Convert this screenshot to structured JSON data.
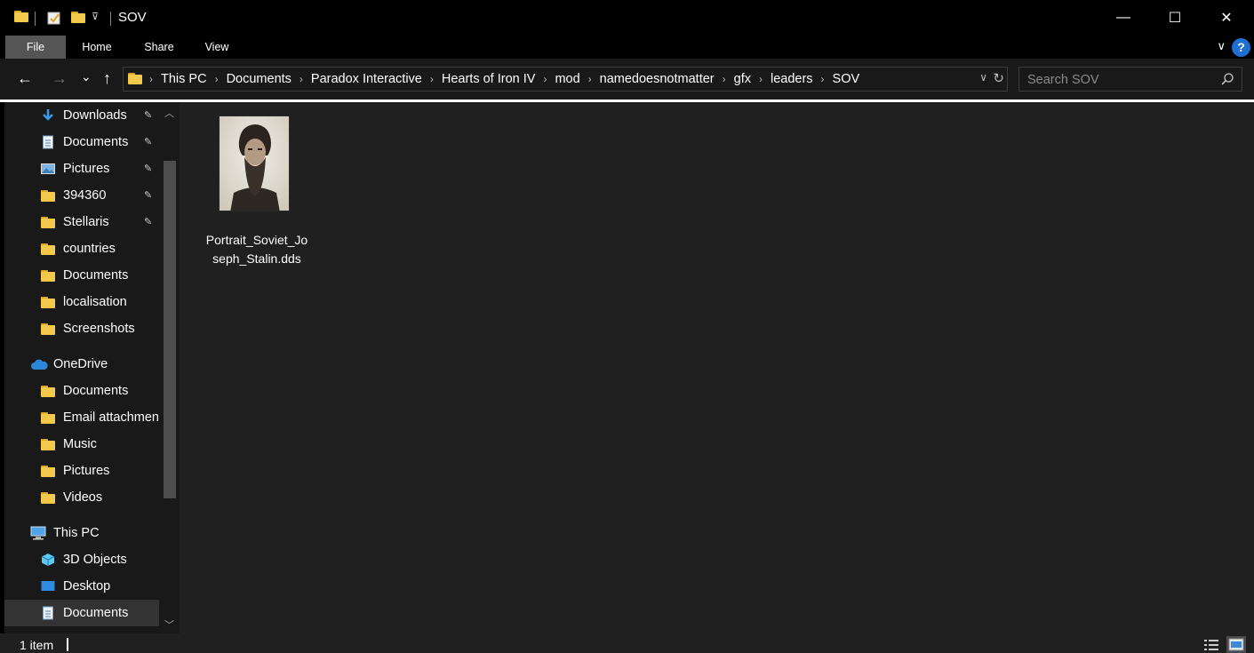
{
  "window": {
    "title": "SOV",
    "minimize_glyph": "—",
    "maximize_glyph": "☐",
    "close_glyph": "✕"
  },
  "ribbon": {
    "tabs": [
      "File",
      "Home",
      "Share",
      "View"
    ],
    "help_glyph": "?",
    "collapse_glyph": "∨"
  },
  "navigation": {
    "back_glyph": "←",
    "forward_glyph": "→",
    "recent_glyph": "⌄",
    "up_glyph": "↑"
  },
  "address": {
    "breadcrumbs": [
      "This PC",
      "Documents",
      "Paradox Interactive",
      "Hearts of Iron IV",
      "mod",
      "namedoesnotmatter",
      "gfx",
      "leaders",
      "SOV"
    ],
    "separator_glyph": "›",
    "dropdown_glyph": "∨",
    "refresh_glyph": "↻"
  },
  "search": {
    "placeholder": "Search SOV"
  },
  "sidebar": {
    "items": [
      {
        "label": "Downloads",
        "icon": "download-arrow-icon",
        "pinned": true
      },
      {
        "label": "Documents",
        "icon": "document-icon",
        "pinned": true
      },
      {
        "label": "Pictures",
        "icon": "pictures-icon",
        "pinned": true
      },
      {
        "label": "394360",
        "icon": "folder-icon",
        "pinned": true
      },
      {
        "label": "Stellaris",
        "icon": "folder-icon",
        "pinned": true
      },
      {
        "label": "countries",
        "icon": "folder-icon",
        "pinned": false
      },
      {
        "label": "Documents",
        "icon": "folder-icon",
        "pinned": false
      },
      {
        "label": "localisation",
        "icon": "folder-icon",
        "pinned": false
      },
      {
        "label": "Screenshots",
        "icon": "folder-icon",
        "pinned": false
      },
      {
        "label": "OneDrive",
        "icon": "onedrive-cloud-icon",
        "pinned": false
      },
      {
        "label": "Documents",
        "icon": "folder-icon",
        "pinned": false
      },
      {
        "label": "Email attachmen",
        "icon": "folder-icon",
        "pinned": false
      },
      {
        "label": "Music",
        "icon": "folder-icon",
        "pinned": false
      },
      {
        "label": "Pictures",
        "icon": "folder-icon",
        "pinned": false
      },
      {
        "label": "Videos",
        "icon": "folder-icon",
        "pinned": false
      },
      {
        "label": "This PC",
        "icon": "this-pc-icon",
        "pinned": false
      },
      {
        "label": "3D Objects",
        "icon": "3d-objects-icon",
        "pinned": false
      },
      {
        "label": "Desktop",
        "icon": "desktop-icon",
        "pinned": false
      },
      {
        "label": "Documents",
        "icon": "document-icon",
        "pinned": false
      }
    ],
    "pin_glyph": "📌",
    "scroll_up_glyph": "▲",
    "scroll_down_glyph": "▼"
  },
  "files": [
    {
      "name": "Portrait_Soviet_Joseph_Stalin.dds",
      "type": "dds-image"
    }
  ],
  "status": {
    "item_count": "1 item"
  },
  "colors": {
    "folder": "#f3c94b",
    "accent_blue": "#1f6fd1",
    "background": "#202020"
  }
}
